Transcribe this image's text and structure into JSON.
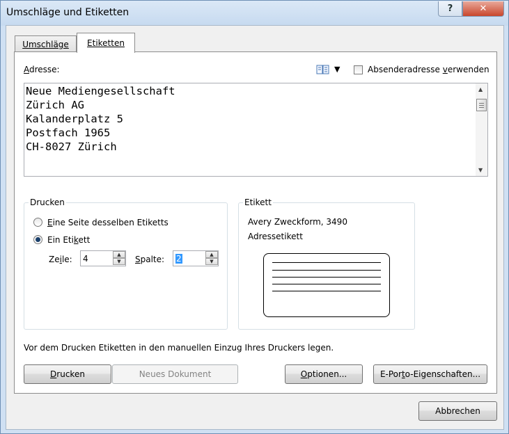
{
  "window": {
    "title": "Umschläge und Etiketten",
    "help_label": "?",
    "close_label": "✕"
  },
  "tabs": [
    {
      "label": "Umschläge",
      "active": false
    },
    {
      "label": "Etiketten",
      "active": true
    }
  ],
  "address": {
    "label_pre": "",
    "label_u": "A",
    "label_post": "dresse:",
    "lines": [
      "Neue Mediengesellschaft",
      "Zürich AG",
      "Kalanderplatz 5",
      "Postfach 1965",
      "CH-8027 Zürich"
    ],
    "addressbook_icon": "address-book-icon",
    "sender_checkbox": {
      "label_pre": "Absenderadresse ",
      "label_u": "v",
      "label_post": "erwenden",
      "checked": false
    }
  },
  "print_group": {
    "title": "Drucken",
    "option_full_page": {
      "pre": "",
      "u": "E",
      "post": "ine Seite desselben Etiketts",
      "checked": false
    },
    "option_single": {
      "pre": "Ein Eti",
      "u": "k",
      "post": "ett",
      "checked": true
    },
    "row_label": {
      "pre": "Ze",
      "u": "i",
      "post": "le:"
    },
    "row_value": "4",
    "col_label": {
      "pre": "",
      "u": "S",
      "post": "palte:"
    },
    "col_value": "2"
  },
  "label_group": {
    "title": "Etikett",
    "vendor": "Avery Zweckform, 3490",
    "type": "Adressetikett"
  },
  "hint": "Vor dem Drucken Etiketten in den manuellen Einzug Ihres Druckers legen.",
  "buttons": {
    "print": {
      "pre": "",
      "u": "D",
      "post": "rucken"
    },
    "new_document": "Neues Dokument",
    "options": {
      "pre": "",
      "u": "O",
      "post": "ptionen..."
    },
    "eporto": {
      "pre": "E-Por",
      "u": "t",
      "post": "o-Eigenschaften..."
    },
    "cancel": "Abbrechen"
  },
  "colors": {
    "frame": "#cfe0f3",
    "close": "#c9462c",
    "selection": "#3399ff"
  }
}
